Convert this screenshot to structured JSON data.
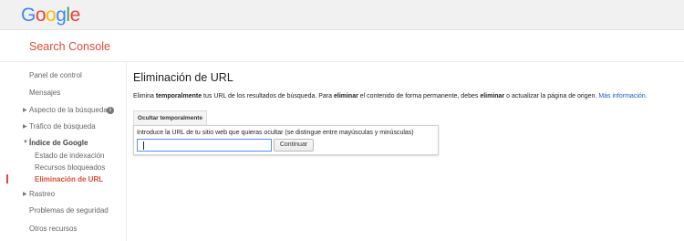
{
  "header": {
    "logo_letters": [
      {
        "ch": "G",
        "color": "#4285f4"
      },
      {
        "ch": "o",
        "color": "#ea4335"
      },
      {
        "ch": "o",
        "color": "#fbbc05"
      },
      {
        "ch": "g",
        "color": "#4285f4"
      },
      {
        "ch": "l",
        "color": "#34a853"
      },
      {
        "ch": "e",
        "color": "#ea4335"
      }
    ],
    "product": "Search Console"
  },
  "sidebar": {
    "items": [
      {
        "label": "Panel de control"
      },
      {
        "label": "Mensajes"
      },
      {
        "label": "Aspecto de la búsqueda",
        "has_help": true,
        "help_icon": "help-icon"
      },
      {
        "label": "Tráfico de búsqueda"
      },
      {
        "label": "Índice de Google",
        "expanded": true
      },
      {
        "label": "Estado de indexación"
      },
      {
        "label": "Recursos bloqueados"
      },
      {
        "label": "Eliminación de URL",
        "active": true
      },
      {
        "label": "Rastreo"
      },
      {
        "label": "Problemas de seguridad"
      },
      {
        "label": "Otros recursos"
      }
    ]
  },
  "main": {
    "title": "Eliminación de URL",
    "description": {
      "p1": "Elimina ",
      "b1": "temporalmente",
      "p2": " tus URL de los resultados de búsqueda. Para ",
      "b2": "eliminar",
      "p3": " el contenido de forma permanente, debes ",
      "b3": "eliminar",
      "p4": " o actualizar la página de origen. ",
      "link": "Más información."
    },
    "tab_label": "Ocultar temporalmente",
    "panel": {
      "label": "Introduce la URL de tu sitio web que quieras ocultar (se distingue entre mayúsculas y minúsculas)",
      "input_value": "",
      "button_label": "Continuar"
    }
  },
  "colors": {
    "brand_red": "#dd4b39",
    "link_blue": "#1a5fc7",
    "focus_blue": "#4d90fe"
  }
}
